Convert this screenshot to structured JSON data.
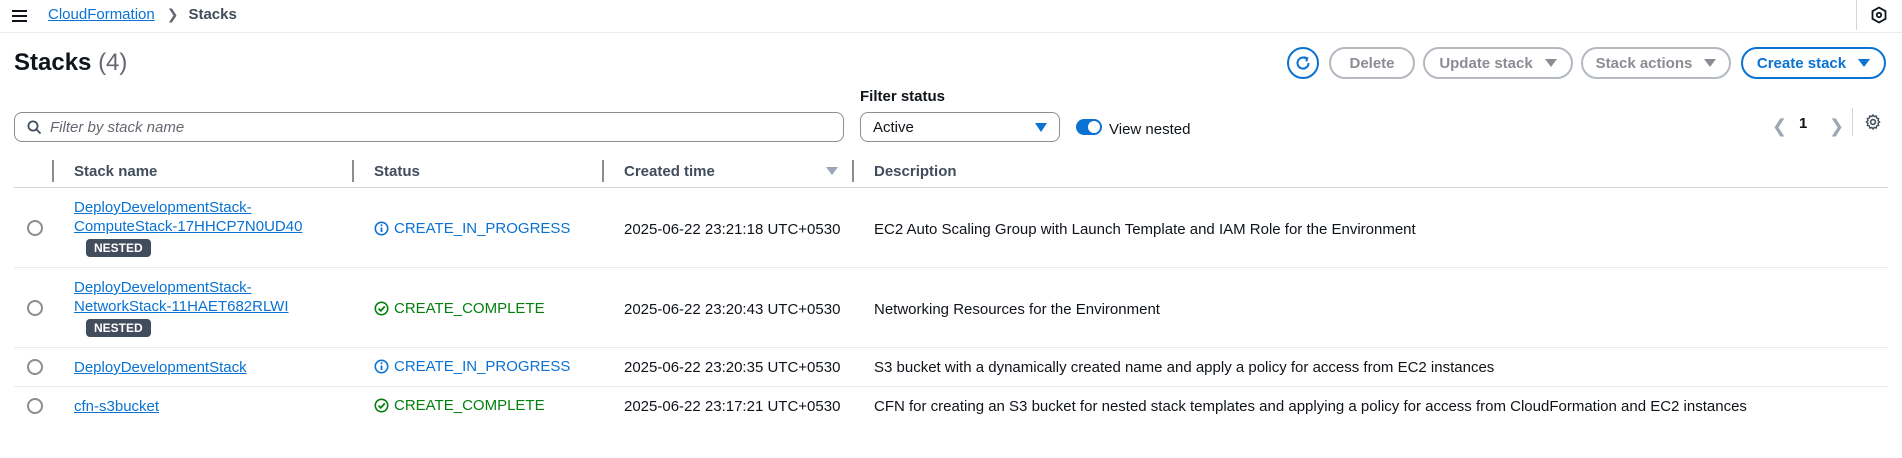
{
  "breadcrumb": {
    "parent": "CloudFormation",
    "current": "Stacks"
  },
  "header": {
    "title": "Stacks",
    "count": "(4)"
  },
  "buttons": {
    "delete": "Delete",
    "update": "Update stack",
    "actions": "Stack actions",
    "create": "Create stack"
  },
  "filter": {
    "placeholder": "Filter by stack name",
    "status_label": "Filter status",
    "status_value": "Active",
    "view_nested_label": "View nested"
  },
  "pagination": {
    "current_page": "1"
  },
  "table": {
    "columns": [
      "Stack name",
      "Status",
      "Created time",
      "Description"
    ],
    "rows": [
      {
        "name_line1": "DeployDevelopmentStack-",
        "name_line2": "ComputeStack-17HHCP7N0UD40",
        "badge": "NESTED",
        "status": "CREATE_IN_PROGRESS",
        "created": "2025-06-22 23:21:18 UTC+0530",
        "description": "EC2 Auto Scaling Group with Launch Template and IAM Role for the Environment"
      },
      {
        "name_line1": "DeployDevelopmentStack-",
        "name_line2": "NetworkStack-11HAET682RLWI",
        "badge": "NESTED",
        "status": "CREATE_COMPLETE",
        "created": "2025-06-22 23:20:43 UTC+0530",
        "description": "Networking Resources for the Environment"
      },
      {
        "name_line1": "DeployDevelopmentStack",
        "status": "CREATE_IN_PROGRESS",
        "created": "2025-06-22 23:20:35 UTC+0530",
        "description": "S3 bucket with a dynamically created name and apply a policy for access from EC2 instances"
      },
      {
        "name_line1": "cfn-s3bucket",
        "status": "CREATE_COMPLETE",
        "created": "2025-06-22 23:17:21 UTC+0530",
        "description": "CFN for creating an S3 bucket for nested stack templates and applying a policy for access from CloudFormation and EC2 instances"
      }
    ]
  },
  "colors": {
    "link": "#0972d3",
    "in_progress": "#0972d3",
    "complete": "#037f0c",
    "badge_bg": "#414d5c"
  }
}
